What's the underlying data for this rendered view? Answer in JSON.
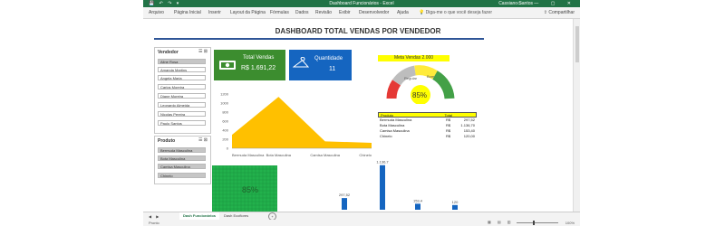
{
  "app": {
    "qat": "💾 ↶ ↷ ▾",
    "title": "Dashboard Funcionários - Excel",
    "user": "Cassiano Santos",
    "window_controls": "▭ — ▢ ✕"
  },
  "ribbon": {
    "tabs": [
      "Arquivo",
      "Página Inicial",
      "Inserir",
      "Layout da Página",
      "Fórmulas",
      "Dados",
      "Revisão",
      "Exibir",
      "Desenvolvedor",
      "Ajuda"
    ],
    "tell_me": "Diga-me o que você deseja fazer",
    "share": "Compartilhar"
  },
  "dashboard": {
    "title": "DASHBOARD TOTAL VENDAS POR VENDEDOR"
  },
  "slicer_vendedor": {
    "title": "Vendedor",
    "items": [
      "Aline Rosa",
      "Amanda Martins",
      "Angela Maria",
      "Carlos Moreira",
      "Diane Moreira",
      "Leonardo Almeida",
      "Nicolas Pereira",
      "Paulo Santos"
    ]
  },
  "slicer_produto": {
    "title": "Produto",
    "items": [
      "Bermuda Masculina",
      "Bota Masculina",
      "Camisa Masculina",
      "Chinelo"
    ]
  },
  "cards": {
    "total_vendas": {
      "label": "Total Vendas",
      "value": "R$ 1.691,22",
      "color": "#3c8d2f"
    },
    "quantidade": {
      "label": "Quantidade",
      "value": "11",
      "color": "#1565c0"
    }
  },
  "gauge": {
    "title": "Meta Vendas 2.000",
    "percent_label": "85%",
    "segment_labels": [
      "Regular",
      "Bom"
    ],
    "colors": [
      "#e53935",
      "#bdbdbd",
      "#ffeb3b",
      "#43a047"
    ]
  },
  "area_chart": {
    "yticks": [
      "1200",
      "1000",
      "800",
      "600",
      "400",
      "200",
      "0"
    ]
  },
  "waffle": {
    "label": "85%"
  },
  "chart_data": [
    {
      "type": "area",
      "categories": [
        "Bermuda Masculina",
        "Bota Masculina",
        "Camisa Masculina",
        "Chinelo"
      ],
      "values": [
        297.52,
        1136.7,
        153.4,
        120
      ],
      "ylim": [
        0,
        1200
      ]
    },
    {
      "type": "bar",
      "categories": [
        "Bermuda Masculina",
        "Bota Masculina",
        "Camisa Masculina",
        "Chinelo"
      ],
      "data_labels": [
        "297,52",
        "1.136,7",
        "153,4",
        "120"
      ],
      "values": [
        297.52,
        1136.7,
        153.4,
        120
      ]
    }
  ],
  "table": {
    "headers": [
      "Produto",
      "Total"
    ],
    "rows": [
      [
        "Bermuda Masculina",
        "R$",
        "297,52"
      ],
      [
        "Bota Masculina",
        "R$",
        "1.136,70"
      ],
      [
        "Camisa Masculina",
        "R$",
        "153,40"
      ],
      [
        "Chinelo",
        "R$",
        "120,00"
      ]
    ]
  },
  "sheet_tabs": {
    "nav": "◀ ▶",
    "tabs": [
      "Dash Funcionários",
      "Dash Ecoflores"
    ],
    "add": "+"
  },
  "status": {
    "ready": "Pronto",
    "views": "▦ ▤ ▥",
    "zoom": "100%"
  }
}
